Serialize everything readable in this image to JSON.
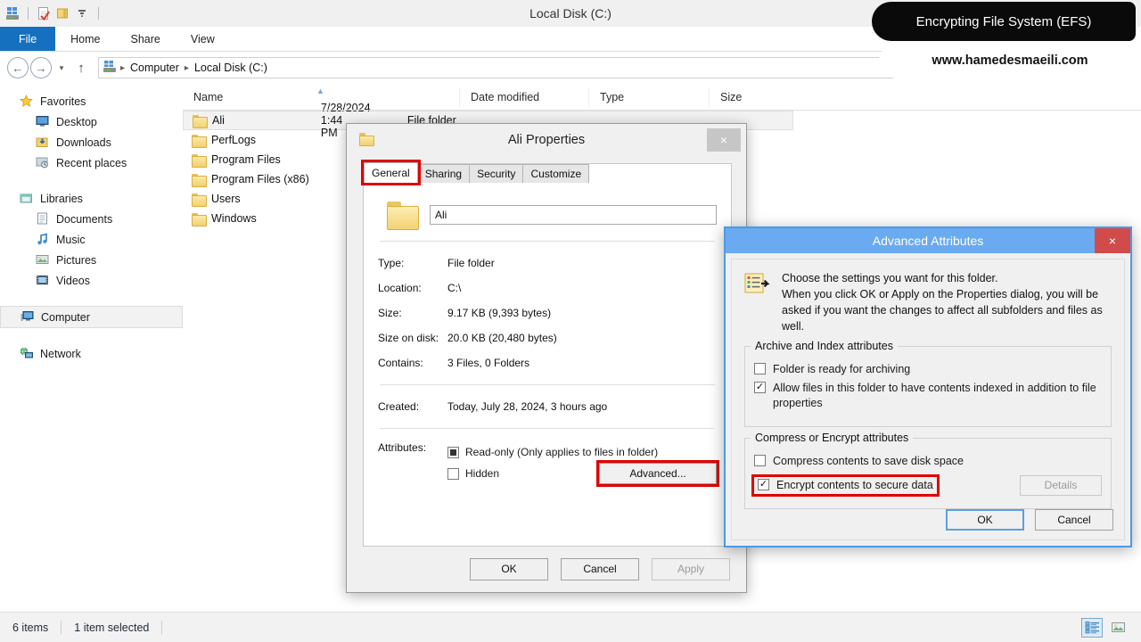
{
  "window": {
    "title": "Local Disk (C:)",
    "quick_access": [
      "computer-drive-icon",
      "new-folder-icon",
      "properties-icon",
      "dropdown-caret-icon"
    ]
  },
  "ribbon": {
    "tabs": [
      {
        "label": "File",
        "active": true
      },
      {
        "label": "Home",
        "active": false
      },
      {
        "label": "Share",
        "active": false
      },
      {
        "label": "View",
        "active": false
      }
    ]
  },
  "address_bar": {
    "back_label": "←",
    "forward_label": "→",
    "recent_caret": "▾",
    "up_label": "↑",
    "breadcrumbs": [
      "Computer",
      "Local Disk (C:)"
    ],
    "separator": "▸",
    "dropdown": "⌄",
    "refresh": "↻"
  },
  "sidebar": {
    "groups": [
      {
        "header": {
          "label": "Favorites",
          "icon": "star-icon"
        },
        "items": [
          {
            "label": "Desktop",
            "icon": "desktop-icon"
          },
          {
            "label": "Downloads",
            "icon": "downloads-icon"
          },
          {
            "label": "Recent places",
            "icon": "recent-places-icon"
          }
        ]
      },
      {
        "header": {
          "label": "Libraries",
          "icon": "libraries-icon"
        },
        "items": [
          {
            "label": "Documents",
            "icon": "document-icon"
          },
          {
            "label": "Music",
            "icon": "music-note-icon"
          },
          {
            "label": "Pictures",
            "icon": "picture-icon"
          },
          {
            "label": "Videos",
            "icon": "video-icon"
          }
        ]
      },
      {
        "header": {
          "label": "Computer",
          "icon": "computer-icon",
          "selected": true
        },
        "items": []
      },
      {
        "header": {
          "label": "Network",
          "icon": "network-icon"
        },
        "items": []
      }
    ]
  },
  "file_list": {
    "columns": [
      "Name",
      "Date modified",
      "Type",
      "Size"
    ],
    "rows": [
      {
        "name": "Ali",
        "date_modified": "7/28/2024 1:44 PM",
        "type": "File folder",
        "size": "",
        "selected": true
      },
      {
        "name": "PerfLogs",
        "date_modified": "",
        "type": "",
        "size": "",
        "selected": false
      },
      {
        "name": "Program Files",
        "date_modified": "",
        "type": "",
        "size": "",
        "selected": false
      },
      {
        "name": "Program Files (x86)",
        "date_modified": "",
        "type": "",
        "size": "",
        "selected": false
      },
      {
        "name": "Users",
        "date_modified": "",
        "type": "",
        "size": "",
        "selected": false
      },
      {
        "name": "Windows",
        "date_modified": "",
        "type": "",
        "size": "",
        "selected": false
      }
    ]
  },
  "status_bar": {
    "item_count": "6 items",
    "selection": "1 item selected",
    "views": [
      {
        "name": "details-view-button",
        "active": true
      },
      {
        "name": "large-icons-view-button",
        "active": false
      }
    ]
  },
  "properties_dialog": {
    "title": "Ali Properties",
    "close_label": "×",
    "tabs": [
      {
        "label": "General",
        "active": true,
        "annotated": true
      },
      {
        "label": "Sharing",
        "active": false,
        "annotated": false
      },
      {
        "label": "Security",
        "active": false,
        "annotated": false
      },
      {
        "label": "Customize",
        "active": false,
        "annotated": false
      }
    ],
    "name_value": "Ali",
    "fields": [
      {
        "label": "Type:",
        "value": "File folder"
      },
      {
        "label": "Location:",
        "value": "C:\\"
      },
      {
        "label": "Size:",
        "value": "9.17 KB (9,393 bytes)"
      },
      {
        "label": "Size on disk:",
        "value": "20.0 KB (20,480 bytes)"
      },
      {
        "label": "Contains:",
        "value": "3 Files, 0 Folders"
      }
    ],
    "created": {
      "label": "Created:",
      "value": "Today, July 28, 2024, 3 hours ago"
    },
    "attributes": {
      "label": "Attributes:",
      "readonly": {
        "label": "Read-only (Only applies to files in folder)",
        "state": "indeterminate"
      },
      "hidden": {
        "label": "Hidden",
        "state": "unchecked"
      },
      "advanced_button": {
        "label": "Advanced...",
        "annotated": true
      }
    },
    "buttons": [
      {
        "label": "OK",
        "disabled": false
      },
      {
        "label": "Cancel",
        "disabled": false
      },
      {
        "label": "Apply",
        "disabled": true
      }
    ]
  },
  "advanced_dialog": {
    "title": "Advanced Attributes",
    "close_label": "×",
    "intro_line1": "Choose the settings you want for this folder.",
    "intro_line2": "When you click OK or Apply on the Properties dialog, you will be asked if you want the changes to affect all subfolders and files as well.",
    "archive_group": {
      "title": "Archive and Index attributes",
      "checkboxes": [
        {
          "label": "Folder is ready for archiving",
          "state": "unchecked"
        },
        {
          "label": "Allow files in this folder to have contents indexed in addition to file properties",
          "state": "checked"
        }
      ]
    },
    "compress_group": {
      "title": "Compress or Encrypt attributes",
      "checkboxes": [
        {
          "label": "Compress contents to save disk space",
          "state": "unchecked",
          "annotated": false
        },
        {
          "label": "Encrypt contents to secure data",
          "state": "checked",
          "annotated": true
        }
      ],
      "details_button": {
        "label": "Details",
        "disabled": true
      }
    },
    "buttons": [
      {
        "label": "OK",
        "focused": true
      },
      {
        "label": "Cancel",
        "focused": false
      }
    ]
  },
  "banner": {
    "heading": "Encrypting File System (EFS)",
    "website": "www.hamedesmaeili.com"
  },
  "colors": {
    "file_tab_blue": "#1570c0",
    "advanced_title_blue": "#6aaaf0",
    "close_red": "#d24b4b",
    "annotation_red": "#e00000"
  }
}
